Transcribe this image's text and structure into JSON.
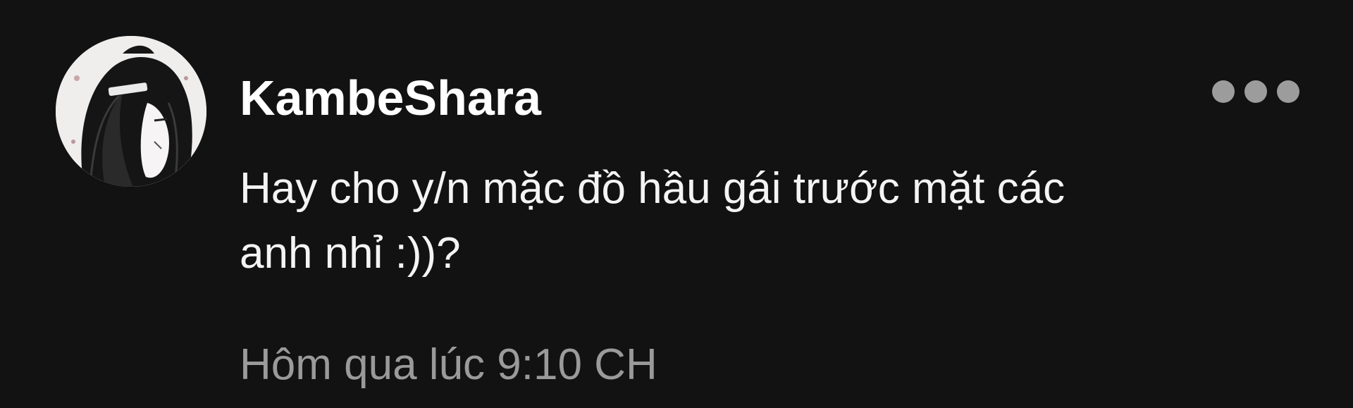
{
  "comment": {
    "avatar_icon": "user-avatar-anime-portrait",
    "username": "KambeShara",
    "more_icon": "more-options-horizontal-dots",
    "message_line1": "Hay cho y/n mặc đồ hầu gái trước mặt các",
    "message_line2": "anh nhỉ :))?",
    "timestamp": "Hôm qua lúc 9:10 CH"
  },
  "colors": {
    "background": "#121212",
    "username": "#ffffff",
    "message": "#f4f4f4",
    "timestamp": "#9a9a9a",
    "more_dots": "#9c9c9c"
  }
}
